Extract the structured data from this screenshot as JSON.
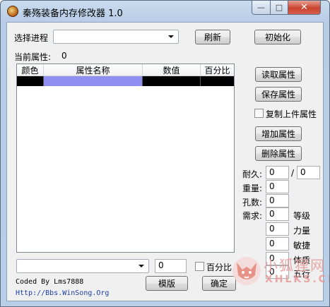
{
  "window": {
    "title": "秦殇装备内存修改器 1.0",
    "min_glyph": "—",
    "max_glyph": "□",
    "close_glyph": "✕"
  },
  "process": {
    "label": "选择进程",
    "selected": "",
    "refresh_label": "刷新",
    "init_label": "初始化"
  },
  "current_attr": {
    "label": "当前属性:",
    "value": "0"
  },
  "attr_list": {
    "columns": [
      "颜色",
      "属性名称",
      "数值",
      "百分比"
    ],
    "row_colors": [
      "#000000",
      "#8f8ff2",
      "#000000",
      "#000000"
    ]
  },
  "side_buttons": {
    "read": "读取属性",
    "save": "保存属性",
    "copy_prev": "复制上件属性",
    "add": "增加属性",
    "delete": "删除属性"
  },
  "durability": {
    "label": "耐久:",
    "current": "0",
    "separator": "/",
    "max": "0"
  },
  "stats": {
    "weight_label": "重量:",
    "weight": "0",
    "holes_label": "孔数:",
    "holes": "0",
    "require_label": "需求:",
    "level": "0",
    "level_label": "等级",
    "strength": "0",
    "strength_label": "力量",
    "agility": "0",
    "agility_label": "敏捷",
    "constitution": "0",
    "constitution_label": "体质",
    "element": "0",
    "element_label": "五行"
  },
  "bottom": {
    "attr_select": "",
    "value": "0",
    "percent_label": "百分比",
    "template_label": "模版",
    "ok_label": "确定"
  },
  "credits": {
    "author": "Coded By Lms7888",
    "url": "Http://Bbs.WinSong.Org"
  },
  "watermark": {
    "text_cn": "小狐狸网",
    "text_en": "XHLKS.CN"
  },
  "colors": {
    "title_bar": "#c9dbee",
    "client_bg": "#f0f0f0",
    "close_red": "#c9432e",
    "selection_blue": "#8f8ff2",
    "link_blue": "#1b3fa6"
  }
}
